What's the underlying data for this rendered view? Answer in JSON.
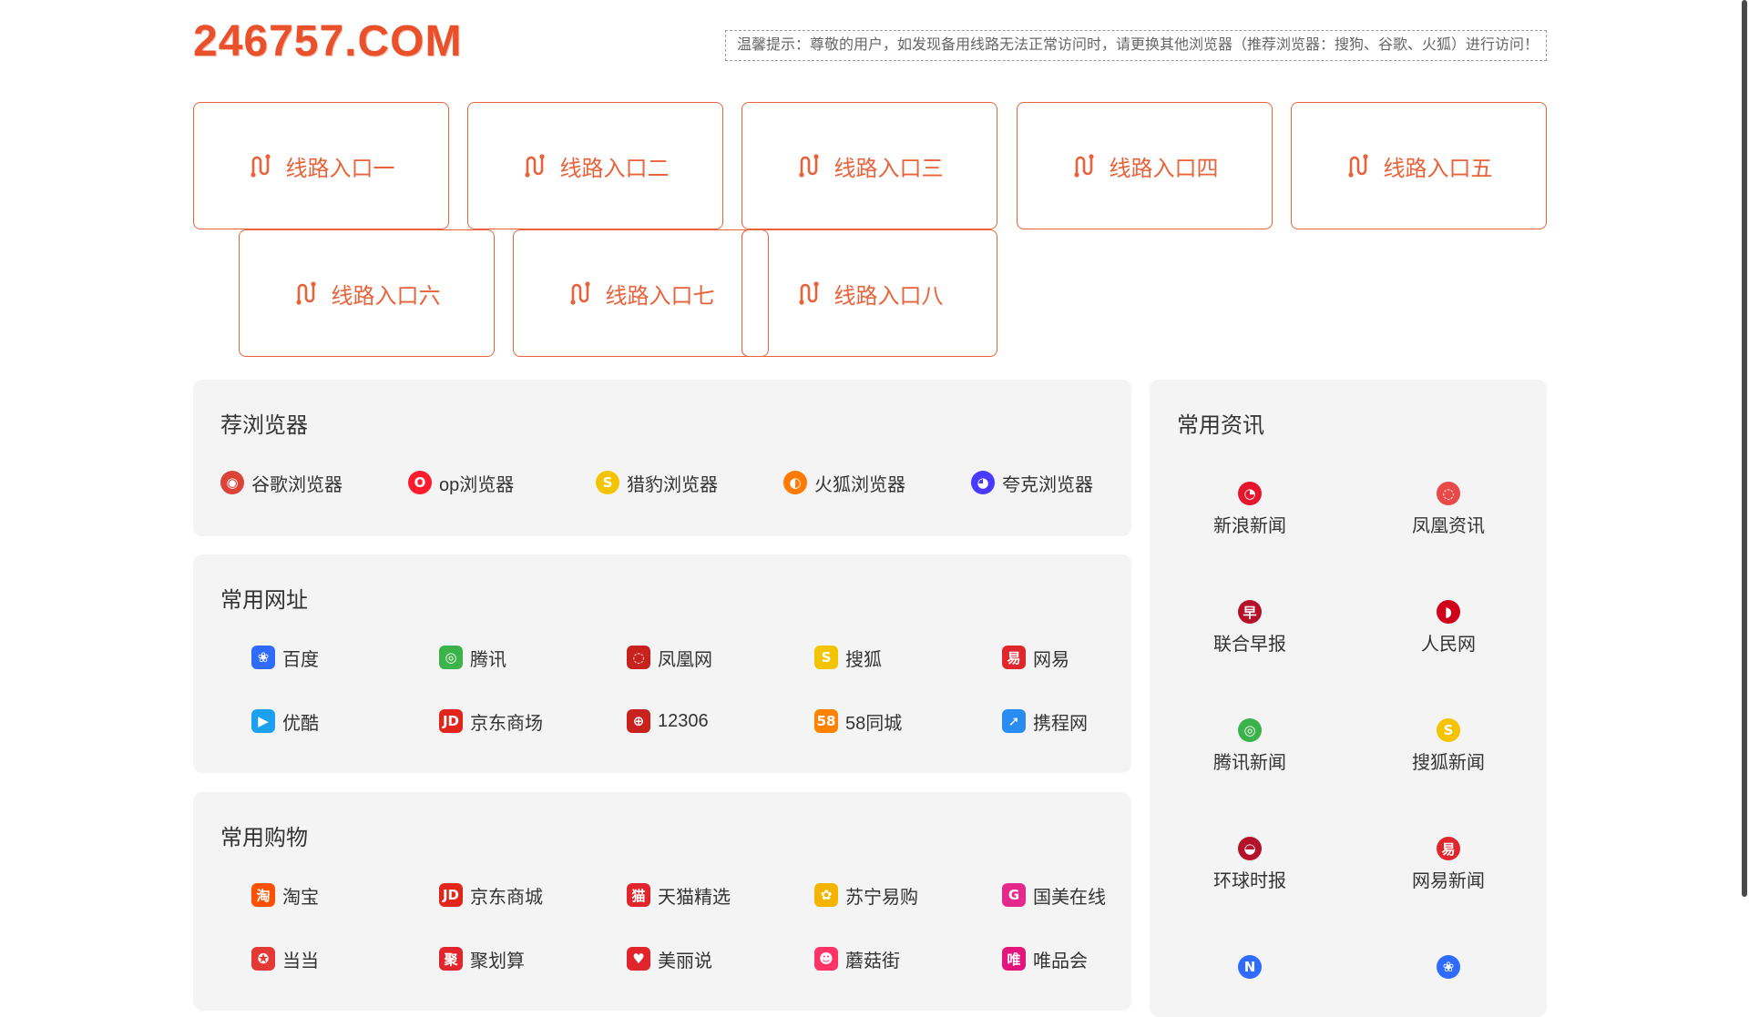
{
  "header": {
    "logo": "246757.COM",
    "notice": "温馨提示：尊敬的用户，如发现备用线路无法正常访问时，请更换其他浏览器（推荐浏览器：搜狗、谷歌、火狐）进行访问！"
  },
  "routes": [
    {
      "label": "线路入口一"
    },
    {
      "label": "线路入口二"
    },
    {
      "label": "线路入口三"
    },
    {
      "label": "线路入口四"
    },
    {
      "label": "线路入口五"
    },
    {
      "label": "线路入口六"
    },
    {
      "label": "线路入口七"
    },
    {
      "label": "线路入口八"
    }
  ],
  "browsers": {
    "title": "荐浏览器",
    "items": [
      {
        "label": "谷歌浏览器",
        "icon": "chrome-icon",
        "color": "#db4437"
      },
      {
        "label": "op浏览器",
        "icon": "opera-icon",
        "color": "#ff1b2d"
      },
      {
        "label": "猎豹浏览器",
        "icon": "cheetah-icon",
        "color": "#f5c400"
      },
      {
        "label": "火狐浏览器",
        "icon": "firefox-icon",
        "color": "#ff7a00"
      },
      {
        "label": "夸克浏览器",
        "icon": "quark-icon",
        "color": "#4a3aff"
      }
    ]
  },
  "sites": {
    "title": "常用网址",
    "items": [
      {
        "label": "百度",
        "icon": "baidu-icon",
        "color": "#2f6bff"
      },
      {
        "label": "腾讯",
        "icon": "tencent-icon",
        "color": "#3bb34a"
      },
      {
        "label": "凤凰网",
        "icon": "ifeng-icon",
        "color": "#c8221f"
      },
      {
        "label": "搜狐",
        "icon": "sohu-icon",
        "color": "#f5c400"
      },
      {
        "label": "网易",
        "icon": "netease-icon",
        "color": "#e0262c"
      },
      {
        "label": "优酷",
        "icon": "youku-icon",
        "color": "#1ea0f0"
      },
      {
        "label": "京东商场",
        "icon": "jd-icon",
        "color": "#e1251b"
      },
      {
        "label": "12306",
        "icon": "railway-icon",
        "color": "#c8221f"
      },
      {
        "label": "58同城",
        "icon": "58-icon",
        "color": "#ff8200"
      },
      {
        "label": "携程网",
        "icon": "ctrip-icon",
        "color": "#2a8cf0"
      }
    ]
  },
  "shopping": {
    "title": "常用购物",
    "items": [
      {
        "label": "淘宝",
        "icon": "taobao-icon",
        "color": "#ff5000"
      },
      {
        "label": "京东商城",
        "icon": "jd-icon",
        "color": "#e1251b"
      },
      {
        "label": "天猫精选",
        "icon": "tmall-icon",
        "color": "#e0262c"
      },
      {
        "label": "苏宁易购",
        "icon": "suning-icon",
        "color": "#f5b400"
      },
      {
        "label": "国美在线",
        "icon": "gome-icon",
        "color": "#e4288c"
      },
      {
        "label": "当当",
        "icon": "dangdang-icon",
        "color": "#e53935"
      },
      {
        "label": "聚划算",
        "icon": "juhuasuan-icon",
        "color": "#e0262c"
      },
      {
        "label": "美丽说",
        "icon": "meilishuo-icon",
        "color": "#e0262c"
      },
      {
        "label": "蘑菇街",
        "icon": "mogujie-icon",
        "color": "#ff3366"
      },
      {
        "label": "唯品会",
        "icon": "vip-icon",
        "color": "#e3157d"
      }
    ]
  },
  "news": {
    "title": "常用资讯",
    "items": [
      {
        "label": "新浪新闻",
        "icon": "sina-weibo-icon",
        "color": "#e6162d"
      },
      {
        "label": "凤凰资讯",
        "icon": "ifeng-icon",
        "color": "#e84a4a"
      },
      {
        "label": "联合早报",
        "icon": "zaobao-icon",
        "color": "#b3122a"
      },
      {
        "label": "人民网",
        "icon": "people-icon",
        "color": "#d0021b"
      },
      {
        "label": "腾讯新闻",
        "icon": "tencent-icon",
        "color": "#3bb34a"
      },
      {
        "label": "搜狐新闻",
        "icon": "sohu-icon",
        "color": "#f5c400"
      },
      {
        "label": "环球时报",
        "icon": "huanqiu-icon",
        "color": "#b3122a"
      },
      {
        "label": "网易新闻",
        "icon": "netease-icon",
        "color": "#e0262c"
      },
      {
        "label": "",
        "icon": "news-icon",
        "color": "#2f6bff"
      },
      {
        "label": "",
        "icon": "baidu-icon",
        "color": "#2f6bff"
      }
    ]
  },
  "colors": {
    "accent": "#e8623a",
    "panel_bg": "#f4f4f4"
  }
}
